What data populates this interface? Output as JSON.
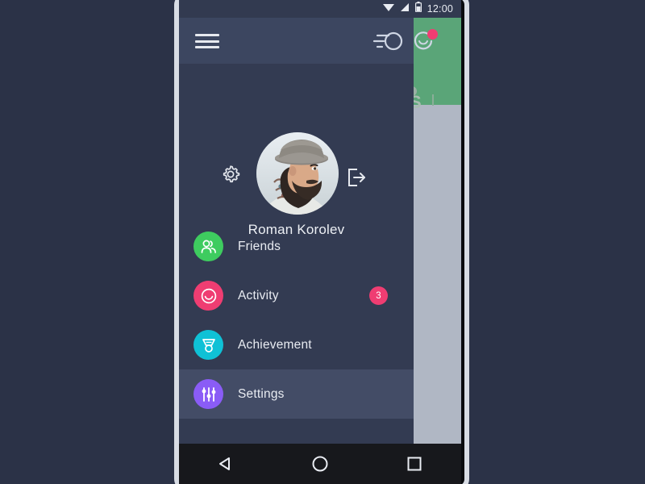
{
  "status_bar": {
    "time": "12:00",
    "icons": [
      "wifi-icon",
      "signal-icon",
      "battery-icon"
    ]
  },
  "toolbar": {
    "menu_icon": "hamburger-menu-icon",
    "speed_icon": "speed-dial-icon",
    "refresh_icon": "refresh-smiley-icon",
    "notification_dot": true
  },
  "profile": {
    "name": "Roman Korolev",
    "settings_icon": "gear-icon",
    "logout_icon": "logout-icon",
    "avatar_alt": "avatar"
  },
  "menu": {
    "items": [
      {
        "label": "Friends",
        "icon": "friends-icon",
        "color": "#3ecc5f",
        "badge": "",
        "active": false
      },
      {
        "label": "Activity",
        "icon": "smiley-icon",
        "color": "#ef3d72",
        "badge": "3",
        "active": false
      },
      {
        "label": "Achievement",
        "icon": "medal-icon",
        "color": "#0fc1d6",
        "badge": "",
        "active": false
      },
      {
        "label": "Settings",
        "icon": "sliders-icon",
        "color": "#8a5cf6",
        "badge": "",
        "active": true
      }
    ]
  },
  "background_app": {
    "header_letter": "S",
    "header_color": "#5aa578"
  },
  "nav_bar": {
    "back_icon": "back-triangle-icon",
    "home_icon": "home-circle-icon",
    "recents_icon": "recents-square-icon"
  },
  "theme": {
    "page_bg": "#2b3247",
    "drawer_bg": "#333b52",
    "toolbar_bg": "#3c4660",
    "active_row_bg": "#434c66",
    "accent_pink": "#ef3d72",
    "text_primary": "#e9ecf2"
  }
}
